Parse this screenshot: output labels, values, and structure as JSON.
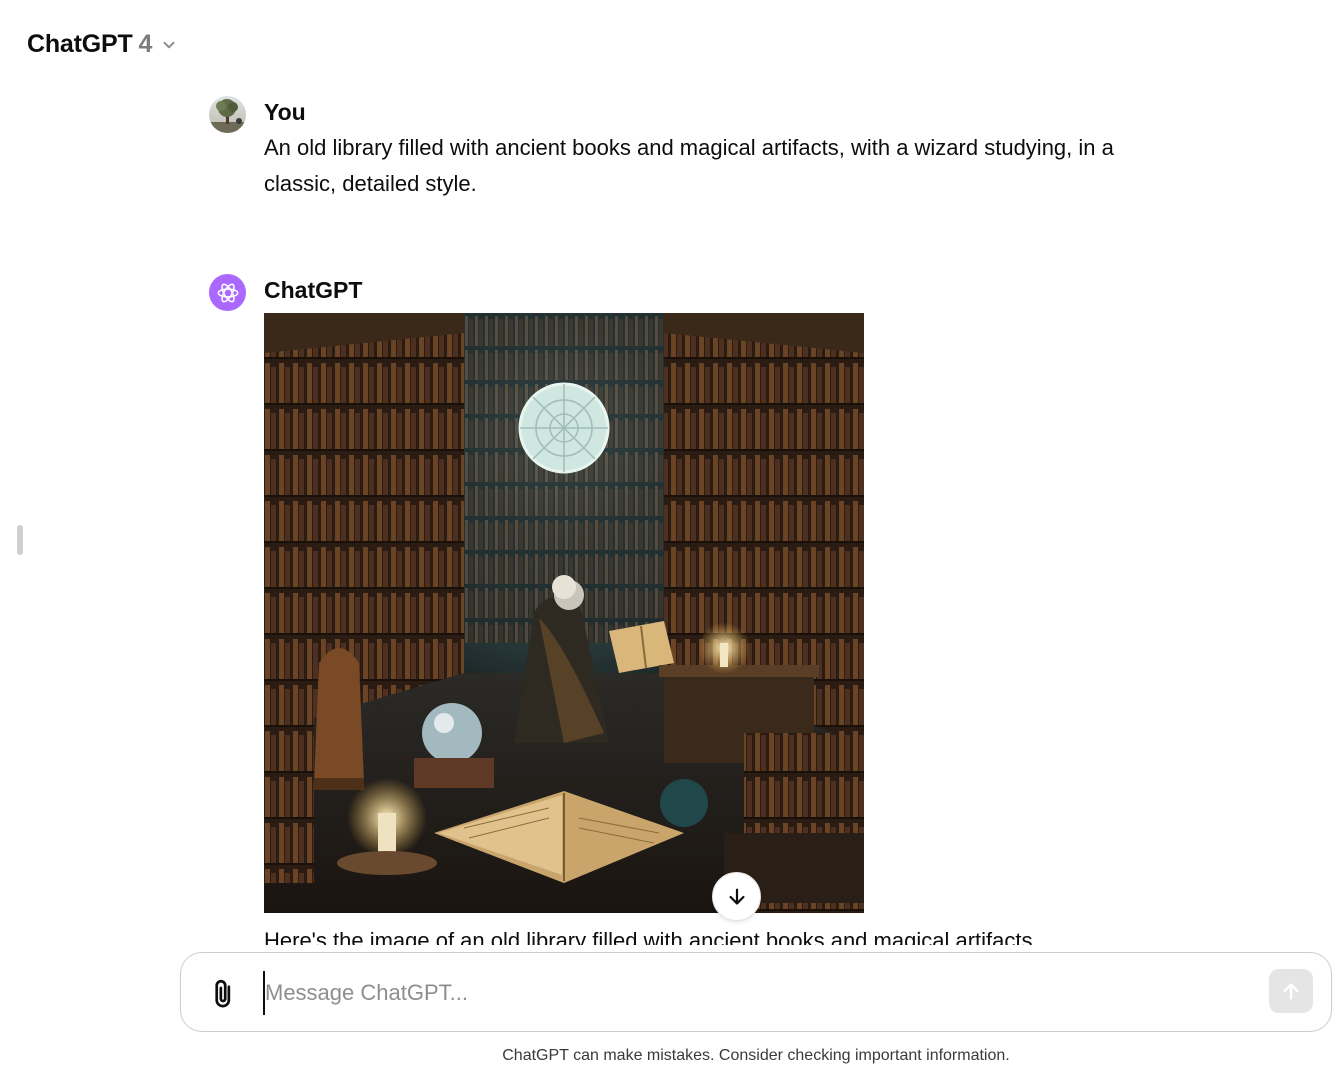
{
  "header": {
    "title": "ChatGPT",
    "version": "4"
  },
  "conversation": {
    "user": {
      "author": "You",
      "text": "An old library filled with ancient books and magical artifacts, with a wizard studying, in a classic, detailed style."
    },
    "assistant": {
      "author": "ChatGPT",
      "image_alt": "Generated image of an old library with a wizard studying",
      "reply_text": "Here's the image of an old library filled with ancient books and magical artifacts,"
    }
  },
  "composer": {
    "placeholder": "Message ChatGPT..."
  },
  "footer": {
    "disclaimer": "ChatGPT can make mistakes. Consider checking important information."
  },
  "icons": {
    "header_chevron": "chevron-down-icon",
    "scroll_down": "arrow-down-icon",
    "attach": "paperclip-icon",
    "send": "arrow-up-icon",
    "assistant_avatar": "openai-logo-icon"
  },
  "colors": {
    "assistant_avatar_bg": "#ab68ff",
    "send_button_bg": "#e5e5e5"
  }
}
